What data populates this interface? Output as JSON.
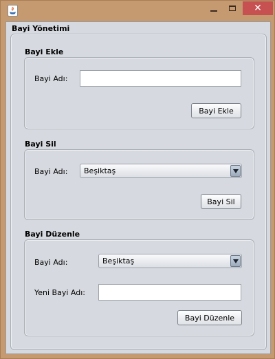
{
  "window": {
    "title": "",
    "panel_title": "Bayi Yönetimi",
    "close_glyph": "✕"
  },
  "add_section": {
    "title": "Bayi Ekle",
    "name_label": "Bayi Adı:",
    "name_value": "",
    "button_label": "Bayi Ekle"
  },
  "delete_section": {
    "title": "Bayi Sil",
    "name_label": "Bayi Adı:",
    "selected": "Beşiktaş",
    "button_label": "Bayi Sil"
  },
  "edit_section": {
    "title": "Bayi Düzenle",
    "name_label": "Bayi Adı:",
    "selected": "Beşiktaş",
    "new_name_label": "Yeni Bayi Adı:",
    "new_name_value": "",
    "button_label": "Bayi Düzenle"
  },
  "colors": {
    "window_frame": "#c59a70",
    "panel_background": "#d6d9df",
    "close_button": "#c75050"
  },
  "icons": {
    "app_icon": "java-icon",
    "minimize": "minimize-icon",
    "maximize": "maximize-icon",
    "close": "close-icon",
    "combo_arrow": "chevron-down-icon"
  }
}
